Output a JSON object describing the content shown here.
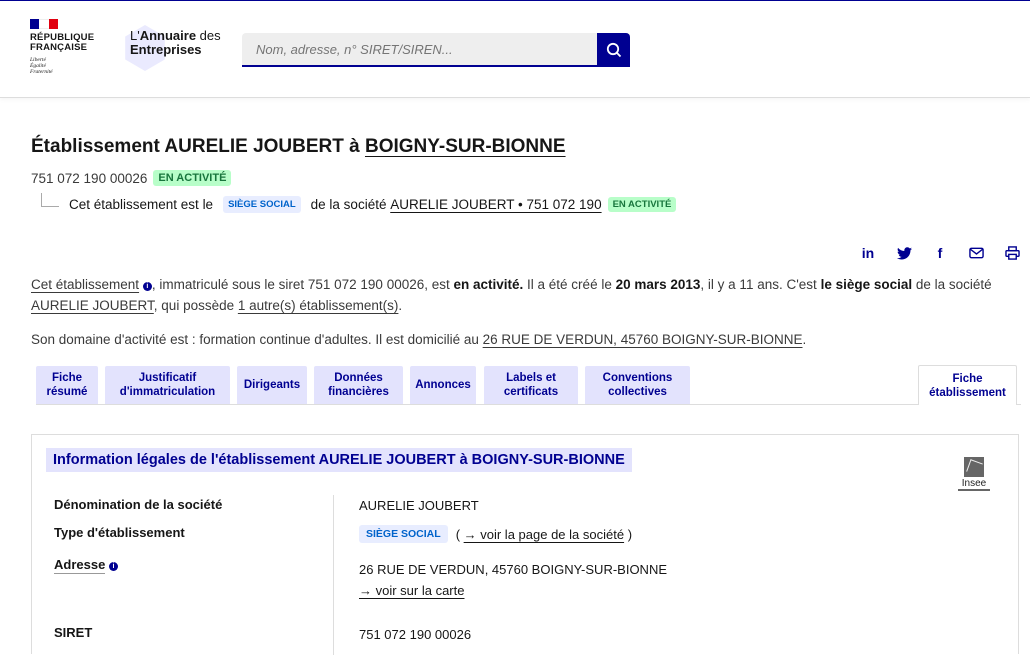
{
  "header": {
    "republic_line1": "RÉPUBLIQUE",
    "republic_line2": "FRANÇAISE",
    "motto1": "Liberté",
    "motto2": "Égalité",
    "motto3": "Fraternité",
    "annuaire_prefix": "L'",
    "annuaire_bold": "Annuaire",
    "annuaire_suffix": " des",
    "annuaire_line2": "Entreprises",
    "search_placeholder": "Nom, adresse, n° SIRET/SIREN...",
    "flag_colors": [
      "#000091",
      "#ffffff",
      "#e1000f"
    ]
  },
  "page": {
    "title_prefix": "Établissement AURELIE JOUBERT à ",
    "title_city": "BOIGNY-SUR-BIONNE",
    "siret": "751 072 190 00026",
    "status": "EN ACTIVITÉ",
    "siege_text_prefix": "Cet établissement est le",
    "siege_badge": "SIÈGE SOCIAL",
    "siege_text_mid": "de la société",
    "siege_company_link": "AURELIE JOUBERT • 751 072 190",
    "siege_status": "EN ACTIVITÉ"
  },
  "share": {
    "icons": [
      "linkedin-icon",
      "twitter-icon",
      "facebook-icon",
      "mail-icon",
      "print-icon"
    ]
  },
  "description": {
    "p1_a": "Cet établissement",
    "p1_b": ", immatriculé sous le siret 751 072 190 00026, est ",
    "p1_c": "en activité.",
    "p1_d": " Il a été créé le ",
    "p1_e": "20 mars 2013",
    "p1_f": ", il y a 11 ans. C'est ",
    "p1_g": "le siège social",
    "p1_h": " de la société ",
    "p1_i": "AURELIE JOUBERT",
    "p1_j": ", qui possède ",
    "p1_k": "1 autre(s) établissement(s)",
    "p1_l": ".",
    "p2_a": "Son domaine d'activité est : formation continue d'adultes. Il est domicilié au ",
    "p2_b": "26 RUE DE VERDUN, 45760 BOIGNY-SUR-BIONNE",
    "p2_c": "."
  },
  "tabs": [
    {
      "line1": "Fiche",
      "line2": "résumé"
    },
    {
      "line1": "Justificatif",
      "line2": "d'immatriculation"
    },
    {
      "line1": "Dirigeants",
      "line2": ""
    },
    {
      "line1": "Données",
      "line2": "financières"
    },
    {
      "line1": "Annonces",
      "line2": ""
    },
    {
      "line1": "Labels et",
      "line2": "certificats"
    },
    {
      "line1": "Conventions",
      "line2": "collectives"
    },
    {
      "line1": "Fiche",
      "line2": "établissement"
    }
  ],
  "card": {
    "title": "Information légales de l'établissement AURELIE JOUBERT à BOIGNY-SUR-BIONNE",
    "insee_label": "Insee",
    "rows": [
      {
        "label": "Dénomination de la société",
        "value": "AURELIE JOUBERT"
      },
      {
        "label": "Type d'établissement",
        "badge": "SIÈGE SOCIAL",
        "link_open": "( ",
        "link": "→ voir la page de la société",
        "link_close": " )"
      },
      {
        "label": "Adresse",
        "value": "26 RUE DE VERDUN, 45760 BOIGNY-SUR-BIONNE",
        "link": "→ voir sur la carte"
      },
      {
        "label": "SIRET",
        "value": "751 072 190 00026"
      }
    ]
  }
}
